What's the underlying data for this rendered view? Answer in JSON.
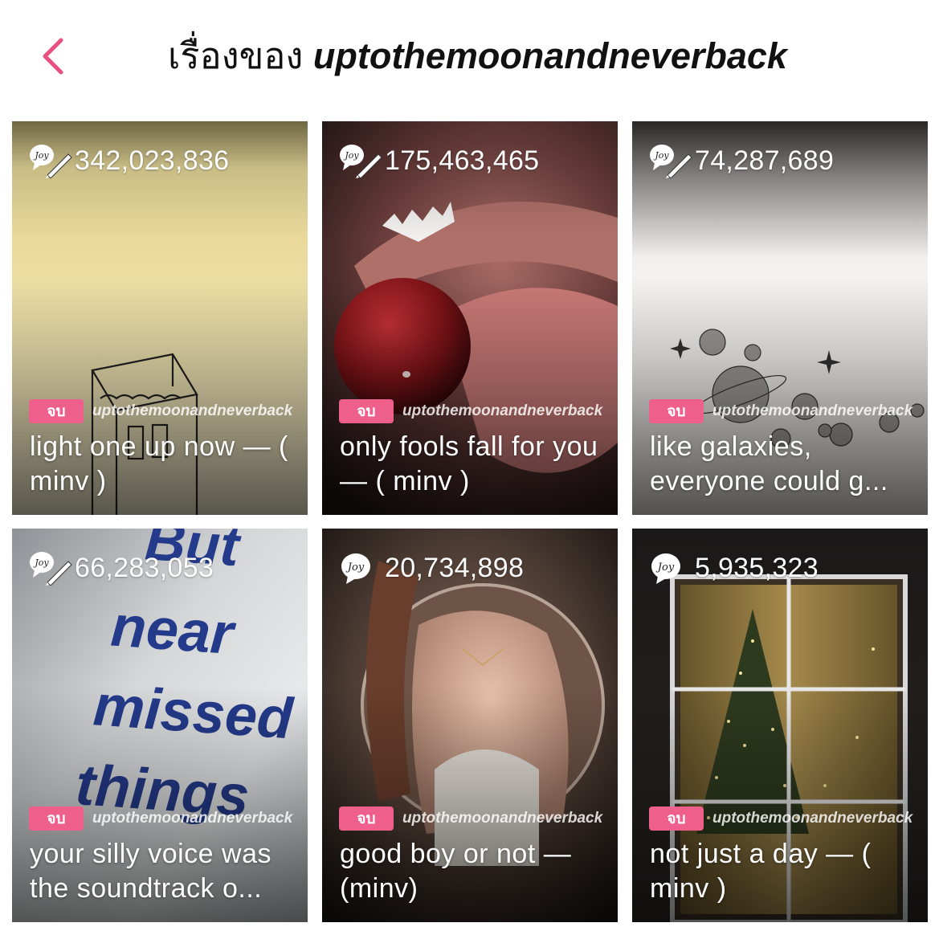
{
  "header": {
    "back_icon": "chevron-left-icon",
    "title_prefix": "เรื่องของ",
    "title_username": "uptothemoonandneverback",
    "accent_color": "#e8507f"
  },
  "stories": [
    {
      "views": "342,023,836",
      "badge": "จบ",
      "author": "uptothemoonandneverback",
      "title": "light one up now — ( minv )",
      "cover": "cigarette-pack-sketch-cover"
    },
    {
      "views": "175,463,465",
      "badge": "จบ",
      "author": "uptothemoonandneverback",
      "title": "only fools fall for you — ( minv )",
      "cover": "lips-lollipop-cover"
    },
    {
      "views": "74,287,689",
      "badge": "จบ",
      "author": "uptothemoonandneverback",
      "title": "like galaxies, everyone could g...",
      "cover": "planets-sketch-cover"
    },
    {
      "views": "66,283,053",
      "badge": "จบ",
      "author": "uptothemoonandneverback",
      "title": "your silly voice was the soundtrack o...",
      "cover": "near-missed-things-bag-cover",
      "cover_text": [
        "But",
        "near",
        "missed",
        "things"
      ]
    },
    {
      "views": "20,734,898",
      "badge": "จบ",
      "author": "uptothemoonandneverback",
      "title": "good boy or not — (minv)",
      "cover": "mirror-portrait-cover"
    },
    {
      "views": "5,935,323",
      "badge": "จบ",
      "author": "uptothemoonandneverback",
      "title": "not just a day — ( minv )",
      "cover": "window-christmas-tree-cover"
    }
  ],
  "joy_icon_label": "Joy"
}
